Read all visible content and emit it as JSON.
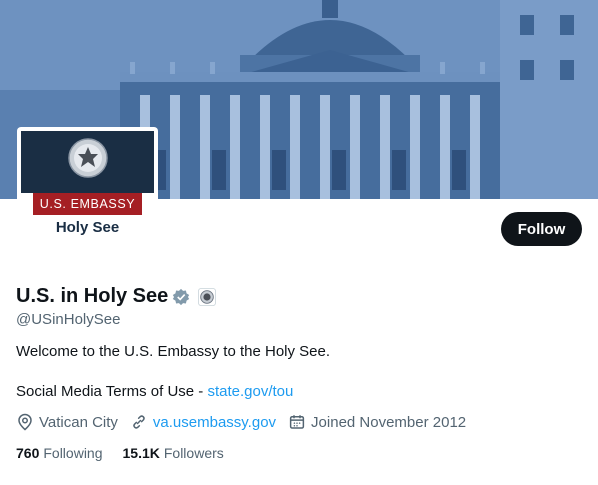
{
  "profile": {
    "display_name": "U.S. in Holy See",
    "handle": "@USinHolySee",
    "bio": "Welcome to the U.S. Embassy to the Holy See.",
    "terms_prefix": "Social Media Terms of Use -",
    "terms_link": "state.gov/tou",
    "location": "Vatican City",
    "website": "va.usembassy.gov",
    "joined": "Joined November 2012",
    "following_count": "760",
    "following_label": "Following",
    "followers_count": "15.1K",
    "followers_label": "Followers",
    "verified_badge": "gray-check-badge",
    "affiliate_badge": "state-department-seal"
  },
  "avatar": {
    "embassy_label": "U.S. EMBASSY",
    "post_label": "Holy See"
  },
  "actions": {
    "follow_label": "Follow"
  },
  "colors": {
    "banner": "#4a6f9f",
    "accent_link": "#1d9bf0",
    "follow_button": "#0f1419",
    "avatar_red": "#a51f24",
    "avatar_navy": "#1a2e44"
  }
}
